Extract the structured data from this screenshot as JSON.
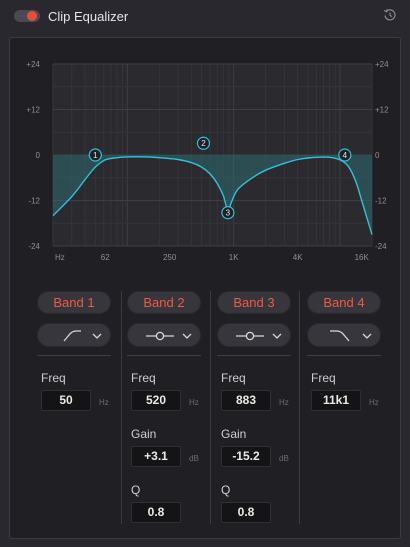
{
  "header": {
    "title": "Clip Equalizer",
    "enabled": true,
    "toggle_color": "#ea4c3c",
    "reset_icon": "reset-icon"
  },
  "graph": {
    "y_ticks": [
      "+24",
      "+12",
      "0",
      "-12",
      "-24"
    ],
    "x_ticks": [
      "Hz",
      "62",
      "250",
      "1K",
      "4K",
      "16K"
    ],
    "curve_color": "#2cc4dc",
    "fill_color": "#2e6b70",
    "nodes": [
      "1",
      "2",
      "3",
      "4"
    ]
  },
  "chart_data": {
    "type": "line",
    "x_scale": "log",
    "xlim": [
      20,
      20000
    ],
    "ylim": [
      -24,
      24
    ],
    "x_tick_labels": [
      "Hz",
      "62",
      "250",
      "1K",
      "4K",
      "16K"
    ],
    "y_tick_labels": [
      "+24",
      "+12",
      "0",
      "-12",
      "-24"
    ],
    "series": [
      {
        "x": [
          20,
          30,
          40,
          50,
          62,
          80,
          100,
          150,
          200,
          300,
          400,
          500,
          600,
          700,
          800,
          883,
          950,
          1100,
          1500,
          2000,
          3000,
          4000,
          5000,
          6000,
          8000,
          10000,
          12000,
          14000,
          16000,
          20000
        ],
        "values": [
          -16,
          -11,
          -6.5,
          -3.2,
          -1.3,
          -0.7,
          -0.5,
          -0.5,
          -0.7,
          -1.2,
          -2,
          -3.2,
          -5,
          -7.5,
          -10.8,
          -14.7,
          -12.5,
          -9,
          -6,
          -4,
          -2.2,
          -1.2,
          -0.8,
          -0.6,
          -0.6,
          -1.3,
          -3,
          -6.8,
          -12,
          -21
        ]
      }
    ],
    "bands": [
      {
        "band": "1",
        "freq": 50,
        "gain_db": 0
      },
      {
        "band": "2",
        "freq": 520,
        "gain_db": 3.1
      },
      {
        "band": "3",
        "freq": 883,
        "gain_db": -15.2
      },
      {
        "band": "4",
        "freq": 11100,
        "gain_db": 0
      }
    ]
  },
  "bands": [
    {
      "label": "Band 1",
      "type_icon": "high-pass-filter-icon",
      "freq_label": "Freq",
      "freq": "50",
      "freq_unit": "Hz"
    },
    {
      "label": "Band 2",
      "type_icon": "bell-filter-icon",
      "freq_label": "Freq",
      "freq": "520",
      "freq_unit": "Hz",
      "gain_label": "Gain",
      "gain": "+3.1",
      "gain_unit": "dB",
      "q_label": "Q",
      "q": "0.8"
    },
    {
      "label": "Band 3",
      "type_icon": "bell-filter-icon",
      "freq_label": "Freq",
      "freq": "883",
      "freq_unit": "Hz",
      "gain_label": "Gain",
      "gain": "-15.2",
      "gain_unit": "dB",
      "q_label": "Q",
      "q": "0.8"
    },
    {
      "label": "Band 4",
      "type_icon": "low-pass-filter-icon",
      "freq_label": "Freq",
      "freq": "11k1",
      "freq_unit": "Hz"
    }
  ],
  "band_label_color": "#ef5a45"
}
